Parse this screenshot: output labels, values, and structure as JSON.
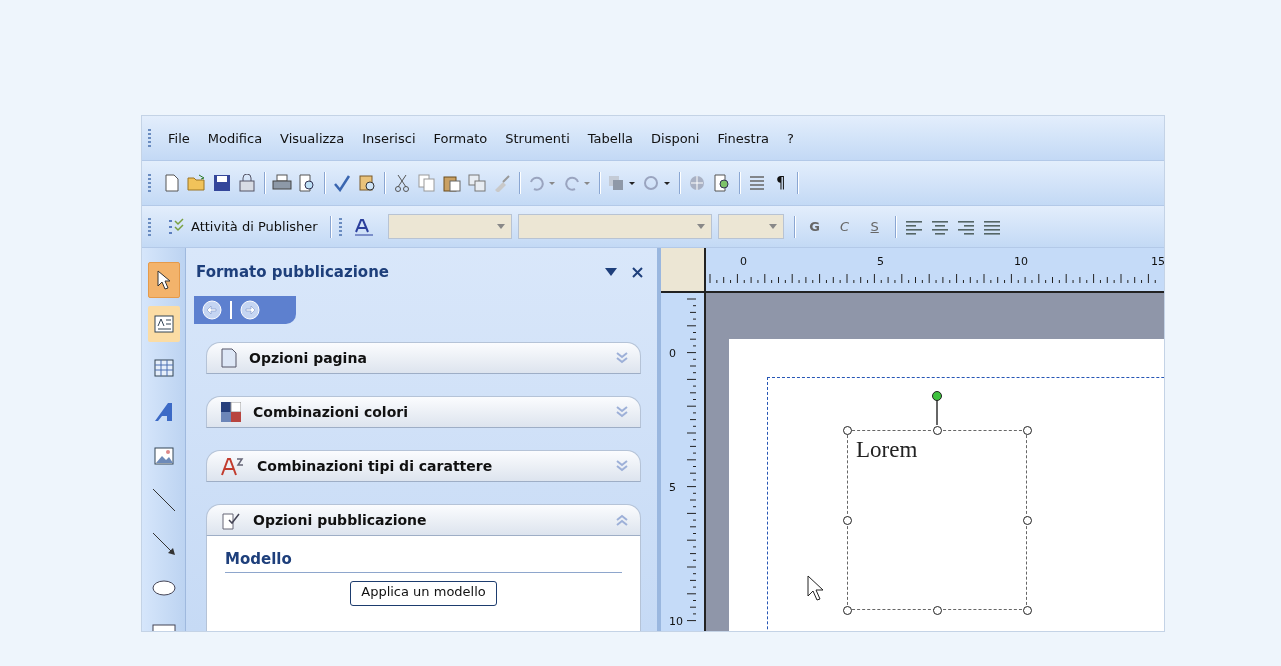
{
  "menu_bar": {
    "items": [
      "File",
      "Modifica",
      "Visualizza",
      "Inserisci",
      "Formato",
      "Strumenti",
      "Tabella",
      "Disponi",
      "Finestra",
      "?"
    ]
  },
  "standard_toolbar": {
    "show_marks": "¶"
  },
  "format_toolbar": {
    "tasks_button": "Attività di Publisher",
    "style_buttons": [
      "G",
      "C",
      "S"
    ]
  },
  "tools": [
    {
      "kind": "pointer",
      "selected": true,
      "hovered": false
    },
    {
      "kind": "textbox",
      "selected": false,
      "hovered": true
    },
    {
      "kind": "table",
      "selected": false,
      "hovered": false
    },
    {
      "kind": "wordart",
      "selected": false,
      "hovered": false
    },
    {
      "kind": "picture",
      "selected": false,
      "hovered": false
    },
    {
      "kind": "line",
      "selected": false,
      "hovered": false
    },
    {
      "kind": "arrow",
      "selected": false,
      "hovered": false
    },
    {
      "kind": "oval",
      "selected": false,
      "hovered": false
    },
    {
      "kind": "rect",
      "selected": false,
      "hovered": false
    }
  ],
  "task_pane": {
    "title": "Formato pubblicazione",
    "sections": [
      {
        "kind": "page",
        "title": "Opzioni pagina",
        "expanded": false
      },
      {
        "kind": "colors",
        "title": "Combinazioni colori",
        "expanded": false
      },
      {
        "kind": "fonts",
        "title": "Combinazioni tipi di carattere",
        "expanded": false
      },
      {
        "kind": "publication",
        "title": "Opzioni pubblicazione",
        "expanded": true,
        "content": {
          "heading": "Modello",
          "button": "Applica un modello"
        }
      }
    ]
  },
  "rulers": {
    "horizontal": [
      "0",
      "5",
      "10",
      "15"
    ],
    "vertical": [
      "0",
      "5",
      "10"
    ]
  },
  "document": {
    "text_box": {
      "text": "Lorem",
      "selected": true
    }
  }
}
